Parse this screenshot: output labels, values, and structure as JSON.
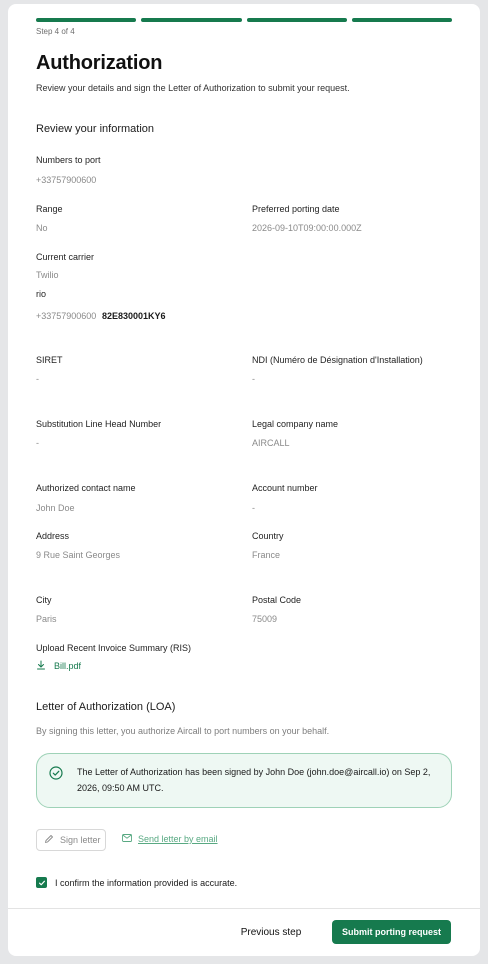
{
  "stepper": {
    "label": "Step 4 of 4",
    "total_steps": 4,
    "completed_steps": 4
  },
  "header": {
    "title": "Authorization",
    "subtitle": "Review your details and sign the Letter of Authorization to submit your request."
  },
  "review": {
    "title": "Review your information",
    "numbers_to_port": {
      "label": "Numbers to port",
      "value": "+33757900600"
    },
    "range": {
      "label": "Range",
      "value": "No"
    },
    "preferred_date": {
      "label": "Preferred porting date",
      "value": "2026-09-10T09:00:00.000Z"
    },
    "current_carrier": {
      "label": "Current carrier",
      "value": "Twilio"
    },
    "rio": {
      "label": "rio",
      "number": "+33757900600",
      "code": "82E830001KY6"
    },
    "siret": {
      "label": "SIRET",
      "value": "-"
    },
    "ndi": {
      "label": "NDI (Numéro de Désignation d'Installation)",
      "value": "-"
    },
    "substitution": {
      "label": "Substitution Line Head Number",
      "value": "-"
    },
    "legal_name": {
      "label": "Legal company name",
      "value": "AIRCALL"
    },
    "contact_name": {
      "label": "Authorized contact name",
      "value": "John Doe"
    },
    "account_number": {
      "label": "Account number",
      "value": "-"
    },
    "address": {
      "label": "Address",
      "value": "9 Rue Saint Georges"
    },
    "country": {
      "label": "Country",
      "value": "France"
    },
    "city": {
      "label": "City",
      "value": "Paris"
    },
    "postal_code": {
      "label": "Postal Code",
      "value": "75009"
    },
    "invoice": {
      "label": "Upload Recent Invoice Summary (RIS)",
      "file": "Bill.pdf"
    }
  },
  "loa": {
    "title": "Letter of Authorization (LOA)",
    "helper": "By signing this letter, you authorize Aircall to port numbers on your behalf.",
    "notice": "The Letter of Authorization has been signed by John Doe (john.doe@aircall.io) on Sep 2, 2026, 09:50 AM UTC.",
    "sign_button": "Sign letter",
    "email_button": "Send letter by email"
  },
  "confirm": {
    "label": "I confirm the information provided is accurate.",
    "checked": true
  },
  "footer": {
    "previous": "Previous step",
    "submit": "Submit porting request"
  },
  "colors": {
    "accent": "#167a4e",
    "notice_bg": "#eef8f3",
    "notice_border": "#9ed2b7"
  },
  "icons": {
    "download": "download-icon",
    "check_circle": "check-circle-icon",
    "pencil": "pencil-icon",
    "mail": "mail-icon",
    "checkbox": "checkmark-icon"
  }
}
